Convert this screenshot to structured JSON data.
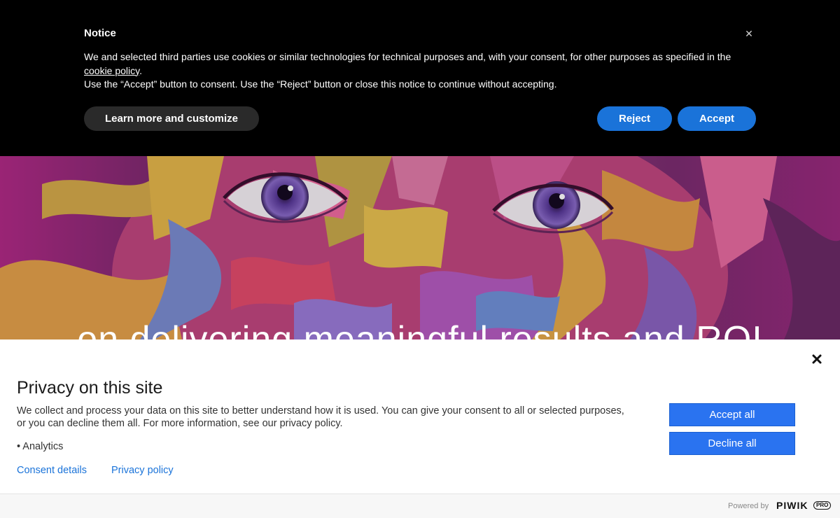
{
  "notice": {
    "title": "Notice",
    "close_icon": "close-icon",
    "text_line1": "We and selected third parties use cookies or similar technologies for technical purposes and, with your consent, for other purposes as specified in the ",
    "cookie_policy_link": "cookie policy",
    "text_line1_end": ".",
    "text_line2": "Use the “Accept” button to consent. Use the “Reject” button or close this notice to continue without accepting.",
    "customize_label": "Learn more and customize",
    "reject_label": "Reject",
    "accept_label": "Accept",
    "accent_color": "#1a73d9"
  },
  "hero": {
    "headline": "on delivering meaningful results and ROI",
    "image": "colorful-painted-face"
  },
  "privacy": {
    "title": "Privacy on this site",
    "description": "We collect and process your data on this site to better understand how it is used. You can give your consent to all or selected purposes, or you can decline them all. For more information, see our privacy policy.",
    "purposes": [
      "• Analytics"
    ],
    "consent_details_label": "Consent details",
    "privacy_policy_label": "Privacy policy",
    "accept_all_label": "Accept all",
    "decline_all_label": "Decline all",
    "close_icon": "close-icon",
    "button_color": "#2a73f0"
  },
  "footer": {
    "powered_by": "Powered by",
    "brand": "PIWIK",
    "brand_suffix": "PRO"
  }
}
